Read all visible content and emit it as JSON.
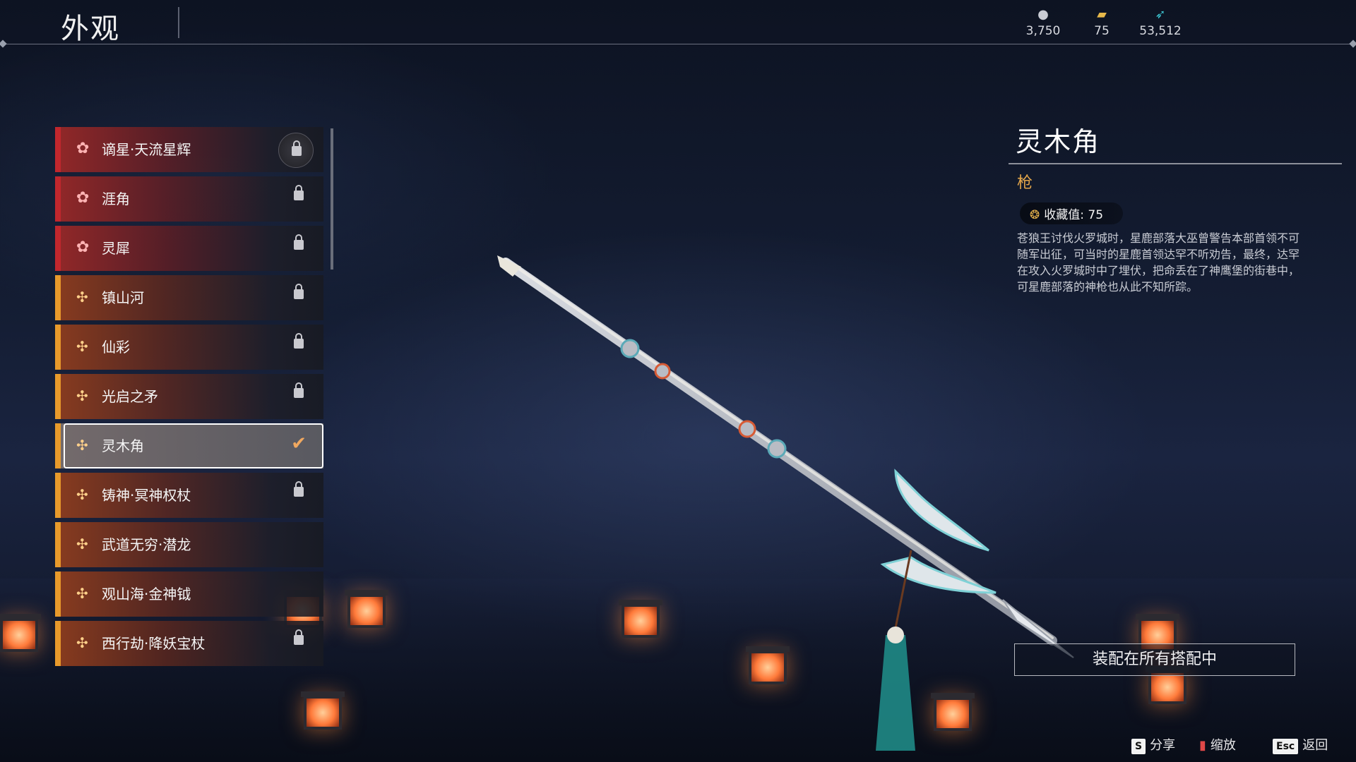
{
  "header": {
    "title": "外观"
  },
  "currencies": [
    {
      "icon": "silver-coin-icon",
      "value": "3,750"
    },
    {
      "icon": "gold-ticket-icon",
      "value": "75"
    },
    {
      "icon": "feather-icon",
      "value": "53,512"
    }
  ],
  "list": {
    "items": [
      {
        "label": "谪星·天流星辉",
        "rarity": "red",
        "status": "locked"
      },
      {
        "label": "涯角",
        "rarity": "red",
        "status": "locked"
      },
      {
        "label": "灵犀",
        "rarity": "red",
        "status": "locked"
      },
      {
        "label": "镇山河",
        "rarity": "orange",
        "status": "locked"
      },
      {
        "label": "仙彩",
        "rarity": "orange",
        "status": "locked"
      },
      {
        "label": "光启之矛",
        "rarity": "orange",
        "status": "locked"
      },
      {
        "label": "灵木角",
        "rarity": "orange",
        "status": "equipped"
      },
      {
        "label": "铸神·冥神权杖",
        "rarity": "orange",
        "status": "locked"
      },
      {
        "label": "武道无穷·潜龙",
        "rarity": "orange",
        "status": ""
      },
      {
        "label": "观山海·金神钺",
        "rarity": "orange",
        "status": ""
      },
      {
        "label": "西行劫·降妖宝杖",
        "rarity": "orange",
        "status": "locked"
      }
    ]
  },
  "detail": {
    "name": "灵木角",
    "type": "枪",
    "collection_label": "收藏值: 75",
    "description": "苍狼王讨伐火罗城时，星鹿部落大巫曾警告本部首领不可随军出征，可当时的星鹿首领达罕不听劝告，最终，达罕在攻入火罗城时中了埋伏，把命丢在了神鹰堡的街巷中，可星鹿部落的神枪也从此不知所踪。"
  },
  "equip_button": {
    "label": "装配在所有搭配中"
  },
  "hints": {
    "share": {
      "key": "S",
      "label": "分享"
    },
    "zoom": {
      "label": "缩放"
    },
    "back": {
      "key": "Esc",
      "label": "返回"
    }
  },
  "colors": {
    "red_rarity": "#c1272d",
    "orange_rarity": "#e89a2b",
    "weapon_type": "#e4a64a",
    "check": "#f0a860"
  }
}
